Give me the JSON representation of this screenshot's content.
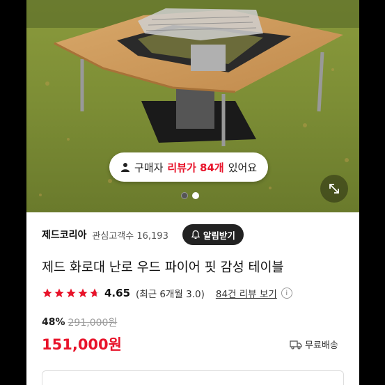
{
  "hero": {
    "review_prefix": "구매자",
    "review_highlight": "리뷰가 84개",
    "review_suffix": "있어요",
    "slide_count": 2,
    "active_slide": 2
  },
  "seller": {
    "name": "제드코리아",
    "follower_label": "관심고객수",
    "follower_count": "16,193",
    "alarm_label": "알림받기"
  },
  "product": {
    "title": "제드 화로대 난로 우드 파이어 핏 감성 테이블",
    "rating": "4.65",
    "star_score": 4.65,
    "recent_rating": "(최근 6개월 3.0)",
    "review_link": "84건 리뷰 보기",
    "discount": "48%",
    "original_price": "291,000원",
    "price": "151,000원",
    "shipping": "무료배송"
  },
  "colors": {
    "accent": "#e8132a",
    "star": "#e8132a"
  }
}
